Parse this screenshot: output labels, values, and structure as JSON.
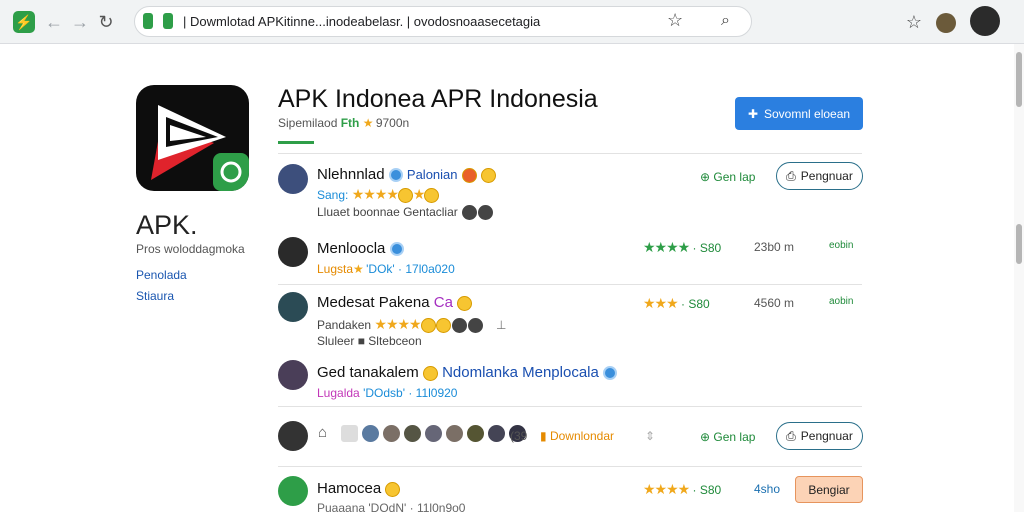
{
  "browser": {
    "url_text": "| Dowmlotad APKitinne...inodeabelasr. | ovodosnoaasecetagia",
    "colors": {
      "toolbar": "#f1f3f4",
      "lock": "#2e9e48"
    }
  },
  "sidebar": {
    "title": "APK.",
    "subtitle": "Pros woloddagmoka",
    "link1": "Penolada",
    "link2": "Stiaura"
  },
  "header": {
    "title": "APK Indonea APR Indonesia",
    "meta_label": "Sipemilaod",
    "meta_tag": "Fth",
    "meta_rating": "9700n",
    "download_button": "Sovomnl eloean"
  },
  "rows": [
    {
      "name": "Nlehnnlad",
      "name_extra": "Palonian",
      "line1_label": "Sang:",
      "line2": "Lluaet boonnae Gentacliar",
      "right_text": "Gen lap",
      "button": "Pengnuar"
    },
    {
      "name": "Menloocla",
      "line1_label": "Lugsta",
      "line1_extra": "'DOk' · 17l0a020",
      "rating_text": "· S80",
      "size": "23b0 m",
      "right_small": "eobin"
    },
    {
      "name": "Medesat Pakena",
      "name_extra": "Ca",
      "line1_label": "Pandaken",
      "line2": "Sluleer ■ Sltebceon",
      "rating_text": "· S80",
      "size": "4560 m",
      "right_small": "aobin"
    },
    {
      "name": "Ged tanakalem",
      "name_extra": "Ndomlanka Menplocala",
      "line1_label": "Lugalda",
      "line1_extra": "'DOdsb' · 11l0920"
    },
    {
      "count": "(39",
      "downloads_label": "Downlondar",
      "right_text": "Gen lap",
      "button": "Pengnuar"
    },
    {
      "name": "Hamocea",
      "line1_label": "Puaaana",
      "line1_extra": "'DOdN' · 11l0n9o0",
      "rating_text": "· S80",
      "size": "4sho",
      "button": "Bengiar"
    }
  ]
}
